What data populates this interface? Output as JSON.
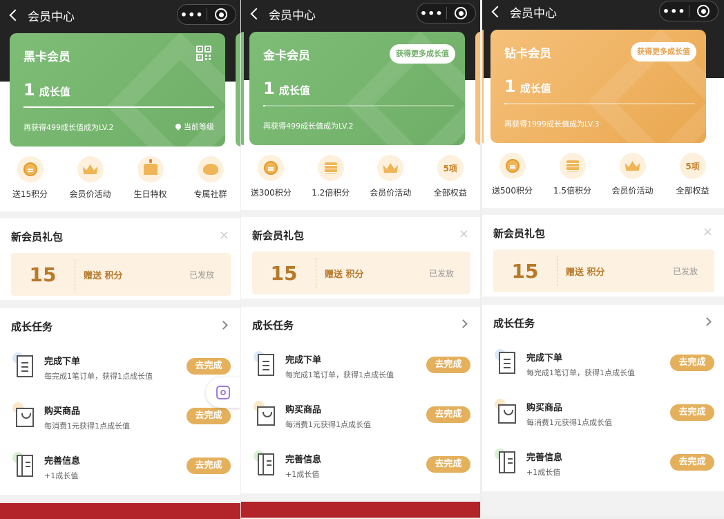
{
  "nav": {
    "title": "会员中心",
    "more": "•••"
  },
  "screens": [
    {
      "card": {
        "name": "黑卡会员",
        "value": "1",
        "unit": "成长值",
        "progress": 1.0,
        "tip": "再获得499成长值成为LV.2",
        "current": "当前等级"
      },
      "benefits": [
        {
          "icon": "coin-icon",
          "label": "送15积分"
        },
        {
          "icon": "crown-icon",
          "label": "会员价活动"
        },
        {
          "icon": "cake-icon",
          "label": "生日特权"
        },
        {
          "icon": "bird-icon",
          "label": "专属社群"
        }
      ],
      "gift": {
        "title": "新会员礼包",
        "close": "×",
        "points": "15",
        "desc": "赠送 积分",
        "status": "已发放"
      },
      "tasks": {
        "title": "成长任务",
        "items": [
          {
            "icon": "order-doc-icon",
            "title": "完成下单",
            "desc": "每完成1笔订单，获得1点成长值",
            "button": "去完成"
          },
          {
            "icon": "shopping-bag-icon",
            "title": "购买商品",
            "desc": "每消费1元获得1点成长值",
            "button": "去完成"
          },
          {
            "icon": "info-book-icon",
            "title": "完善信息",
            "desc": "+1成长值",
            "button": "去完成"
          }
        ]
      }
    },
    {
      "card": {
        "name": "金卡会员",
        "value": "1",
        "unit": "成长值",
        "progress": 0.01,
        "tip": "再获得499成长值成为LV.2",
        "getmore": "获得更多成长值"
      },
      "benefits": [
        {
          "icon": "coin-icon",
          "label": "送300积分"
        },
        {
          "icon": "stack-icon",
          "label": "1.2倍积分"
        },
        {
          "icon": "crown-icon",
          "label": "会员价活动"
        },
        {
          "icon": "text",
          "label": "全部权益",
          "text": "5项"
        }
      ],
      "gift": {
        "title": "新会员礼包",
        "close": "×",
        "points": "15",
        "desc": "赠送 积分",
        "status": "已发放"
      },
      "tasks": {
        "title": "成长任务",
        "items": [
          {
            "icon": "order-doc-icon",
            "title": "完成下单",
            "desc": "每完成1笔订单，获得1点成长值",
            "button": "去完成"
          },
          {
            "icon": "shopping-bag-icon",
            "title": "购买商品",
            "desc": "每消费1元获得1点成长值",
            "button": "去完成"
          },
          {
            "icon": "info-book-icon",
            "title": "完善信息",
            "desc": "+1成长值",
            "button": "去完成"
          }
        ]
      }
    },
    {
      "card": {
        "name": "钻卡会员",
        "value": "1",
        "unit": "成长值",
        "progress": 0.01,
        "tip": "再获得1999成长值成为LV.3",
        "getmore": "获得更多成长值"
      },
      "benefits": [
        {
          "icon": "coin-icon",
          "label": "送500积分"
        },
        {
          "icon": "stack-icon",
          "label": "1.5倍积分"
        },
        {
          "icon": "crown-icon",
          "label": "会员价活动"
        },
        {
          "icon": "text",
          "label": "全部权益",
          "text": "5项"
        }
      ],
      "gift": {
        "title": "新会员礼包",
        "close": "×",
        "points": "15",
        "desc": "赠送 积分",
        "status": "已发放"
      },
      "tasks": {
        "title": "成长任务",
        "items": [
          {
            "icon": "order-doc-icon",
            "title": "完成下单",
            "desc": "每完成1笔订单，获得1点成长值",
            "button": "去完成"
          },
          {
            "icon": "shopping-bag-icon",
            "title": "购买商品",
            "desc": "每消费1元获得1点成长值",
            "button": "去完成"
          },
          {
            "icon": "info-book-icon",
            "title": "完善信息",
            "desc": "+1成长值",
            "button": "去完成"
          }
        ]
      }
    }
  ],
  "colors": {
    "green_card": "#7dbd76",
    "gold_card": "#f5c07a",
    "button": "#e4b05c",
    "accent_text": "#b8792a"
  }
}
